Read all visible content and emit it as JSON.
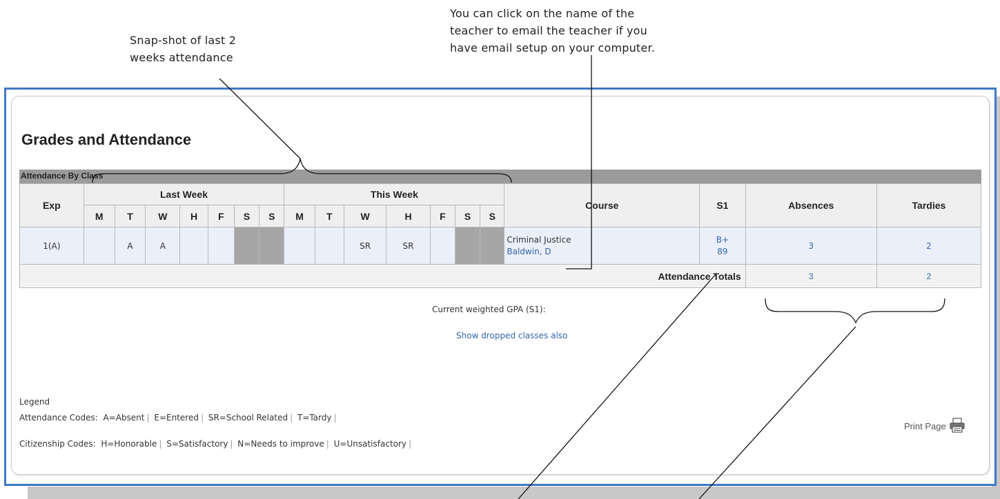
{
  "callouts": {
    "snapshot": [
      "Snap-shot of last 2",
      "weeks attendance"
    ],
    "email": [
      "You can click on the name of the",
      "teacher to email the teacher if you",
      "have email setup on your computer."
    ]
  },
  "page_title": "Grades and Attendance",
  "section_title": "Attendance By Class",
  "table": {
    "exp_header": "Exp",
    "last_week_header": "Last Week",
    "this_week_header": "This Week",
    "course_header": "Course",
    "s1_header": "S1",
    "absences_header": "Absences",
    "tardies_header": "Tardies",
    "day_headers": [
      "M",
      "T",
      "W",
      "H",
      "F",
      "S",
      "S",
      "M",
      "T",
      "W",
      "H",
      "F",
      "S",
      "S"
    ],
    "row": {
      "exp": "1(A)",
      "days": [
        "",
        "A",
        "A",
        "",
        "",
        "",
        "",
        "",
        "",
        "SR",
        "SR",
        "",
        "",
        ""
      ],
      "course": "Criminal Justice",
      "teacher": "Baldwin, D",
      "grade_letter": "B+",
      "grade_pct": "89",
      "absences": "3",
      "tardies": "2"
    },
    "totals_label": "Attendance Totals",
    "totals_absences": "3",
    "totals_tardies": "2"
  },
  "gpa_label": "Current weighted GPA (S1):",
  "dropped_link": "Show dropped classes also",
  "legend": {
    "title": "Legend",
    "attendance_label": "Attendance Codes:",
    "attendance_codes": [
      "A=Absent",
      "E=Entered",
      "SR=School Related",
      "T=Tardy"
    ],
    "citizenship_label": "Citizenship Codes:",
    "citizenship_codes": [
      "H=Honorable",
      "S=Satisfactory",
      "N=Needs to improve",
      "U=Unsatisfactory"
    ]
  },
  "print_label": "Print Page",
  "icons": {
    "print": "printer-icon"
  },
  "colors": {
    "frame": "#3f78c4",
    "link": "#3366aa",
    "section_bar": "#9b9b9b",
    "row_bg": "#eaeff9"
  }
}
